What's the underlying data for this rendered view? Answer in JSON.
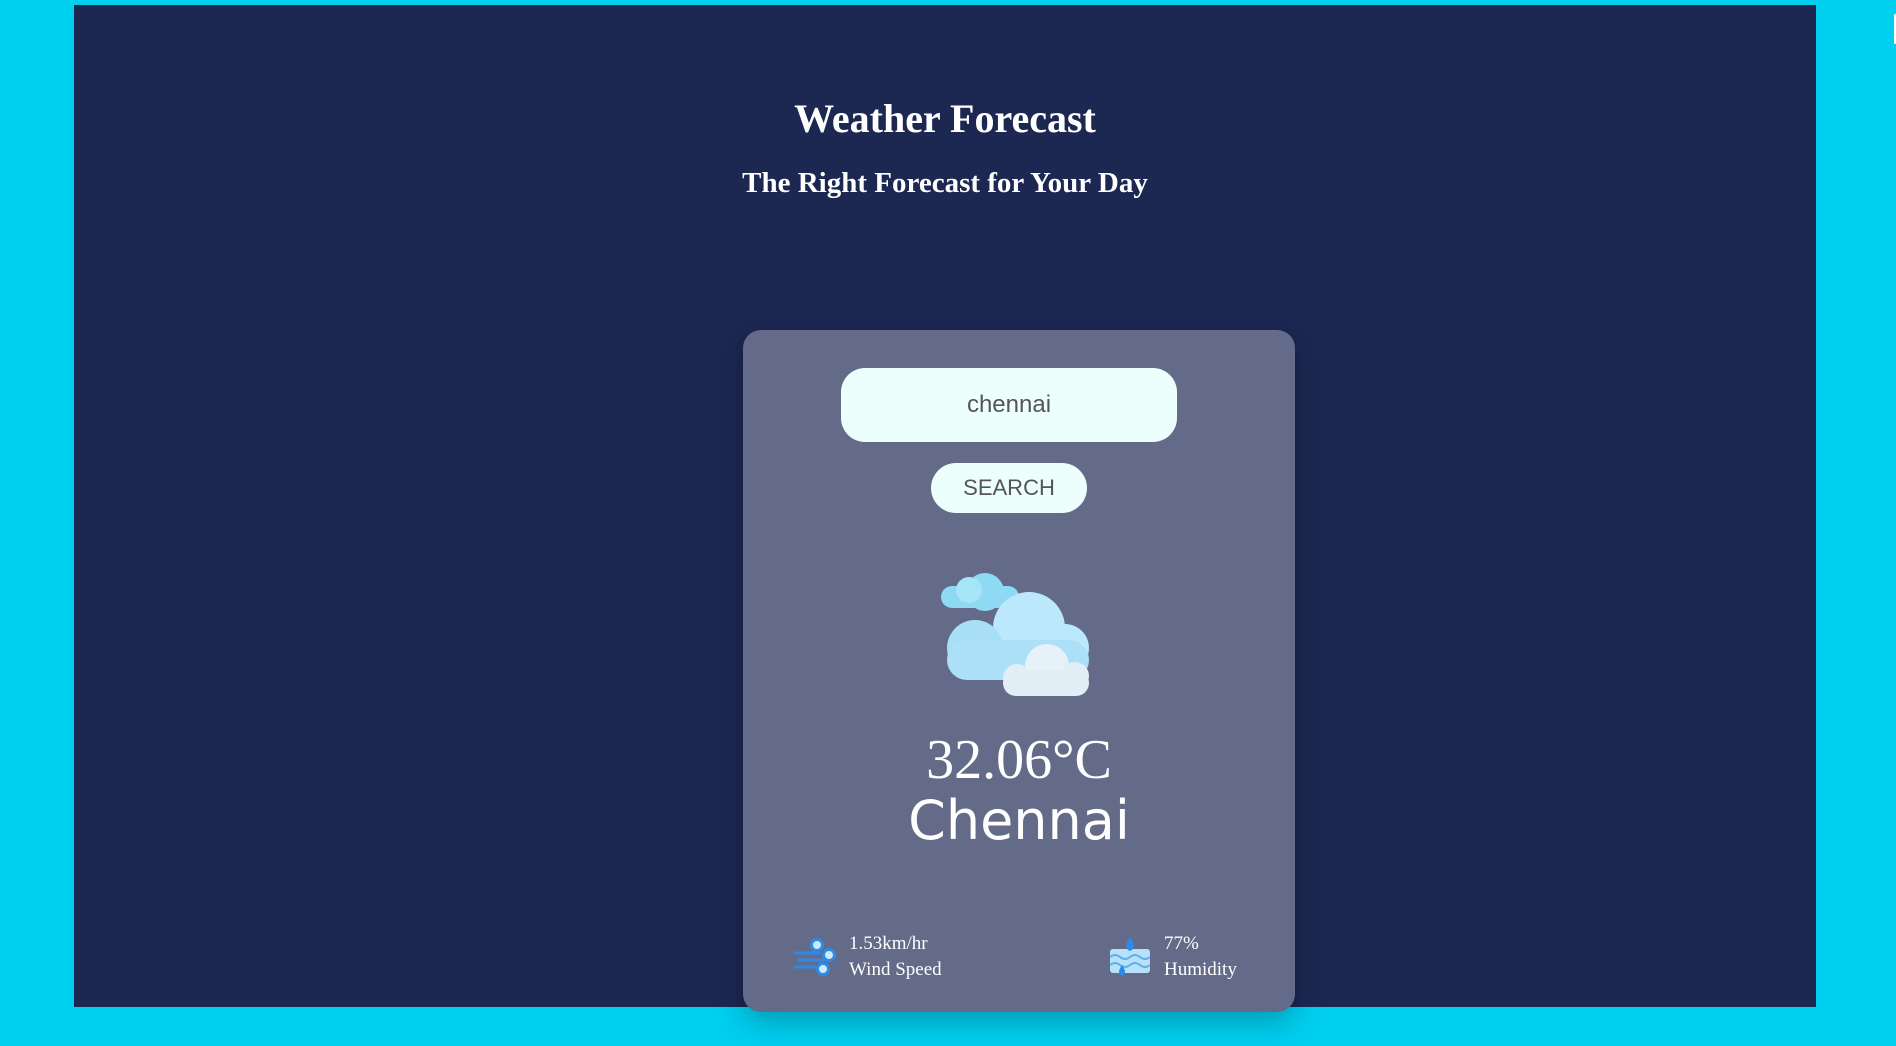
{
  "header": {
    "title": "Weather Forecast",
    "subtitle": "The Right Forecast for Your Day"
  },
  "search": {
    "value": "chennai",
    "button_label": "SEARCH"
  },
  "weather": {
    "icon": "cloudy-icon",
    "temperature": "32.06°C",
    "city": "Chennai"
  },
  "details": {
    "wind": {
      "icon": "wind-icon",
      "value": "1.53km/hr",
      "label": "Wind Speed"
    },
    "humidity": {
      "icon": "humidity-icon",
      "value": "77%",
      "label": "Humidity"
    }
  },
  "colors": {
    "outer_background": "#00CFF0",
    "panel_background": "#1C2752",
    "card_background": "#636B88",
    "input_background": "#ECFFFD",
    "text": "#FFFFFF"
  }
}
